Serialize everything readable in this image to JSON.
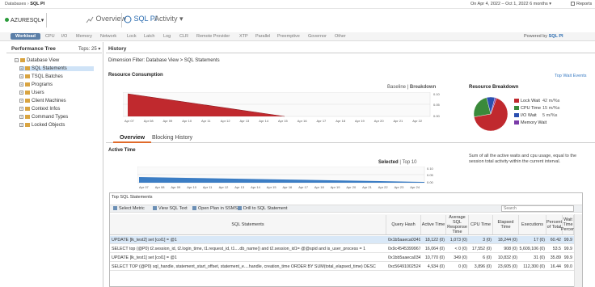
{
  "breadcrumb": {
    "parent": "Databases",
    "separator": "›",
    "current": "SQL PI"
  },
  "date_range": "On Apr 4, 2022 – Oct 1, 2022 6 months ▾",
  "reports_label": "Reports",
  "server": {
    "name": "AZURESQL",
    "chevron": "▾",
    "status_color": "#2a9b3a"
  },
  "nav": {
    "overview": "Overview",
    "sqlpi": "SQL PI",
    "activity": "Activity ▾"
  },
  "categories": [
    "Workload",
    "CPU",
    "I/O",
    "Memory",
    "Network",
    "Lock",
    "Latch",
    "Log",
    "CLR",
    "Remote Provider",
    "XTP",
    "Parallel",
    "Preemptive",
    "Governor",
    "Other"
  ],
  "powered_by": {
    "prefix": "Powered by",
    "brand": "SQL PI"
  },
  "performance_tree": {
    "title": "Performance Tree",
    "tops": "Tops: 25 ▾",
    "items": [
      "Database View",
      "SQL Statements",
      "TSQL Batches",
      "Programs",
      "Users",
      "Client Machines",
      "Context Infos",
      "Command Types",
      "Locked Objects"
    ]
  },
  "history": {
    "title": "History",
    "dimension_filter": "Dimension Filter: Database View > SQL Statements",
    "resource_consumption": "Resource Consumption",
    "baseline": "Baseline",
    "breakdown": "Breakdown",
    "resource_breakdown": "Resource Breakdown",
    "top_wait_events": "Top Wait Events",
    "legend": [
      {
        "label": "Lock Wait",
        "value": "42 m/%s",
        "color": "#c0292e"
      },
      {
        "label": "CPU Time",
        "value": "15 m/%s",
        "color": "#3a8a3a"
      },
      {
        "label": "I/O Wait",
        "value": "5 m/%s",
        "color": "#2a4fb0"
      },
      {
        "label": "Memory Wait",
        "value": "",
        "color": "#7a3aa8"
      }
    ],
    "pie_values": [
      42,
      15,
      5,
      1
    ]
  },
  "rc_chart": {
    "x_labels": [
      "Apr 07",
      "Apr 08",
      "Apr 09",
      "Apr 10",
      "Apr 11",
      "Apr 12",
      "Apr 13",
      "Apr 14",
      "Apr 15",
      "Apr 16",
      "Apr 17",
      "Apr 18",
      "Apr 19",
      "Apr 20",
      "Apr 21",
      "Apr 22"
    ],
    "y_labels": [
      "0.10",
      "0.05",
      "0.00"
    ]
  },
  "subtabs": {
    "overview": "Overview",
    "blocking_history": "Blocking History"
  },
  "active_time": {
    "title": "Active Time",
    "selected": "Selected",
    "top": "Top 10",
    "description": "Sum of all the active waits and cpu usage, equal to the session total activity within the current interval.",
    "x_labels": [
      "Apr 07",
      "Apr 08",
      "Apr 09",
      "Apr 10",
      "Apr 11",
      "Apr 12",
      "Apr 13",
      "Apr 14",
      "Apr 15",
      "Apr 16",
      "Apr 17",
      "Apr 18",
      "Apr 19",
      "Apr 20",
      "Apr 21",
      "Apr 22",
      "Apr 23",
      "Apr 24"
    ],
    "y_labels": [
      "0.10",
      "0.05",
      "0.00"
    ]
  },
  "top_sql": {
    "title": "Top SQL Statements",
    "toolbar": {
      "select_metric": "Select Metric",
      "view_sql": "View SQL Text",
      "open_ssms": "Open Plan in SSMS",
      "drill": "Drill to SQL Statement"
    },
    "search_placeholder": "Search",
    "headers": [
      "SQL Statements",
      "Query Hash",
      "Active Time",
      "Average SQL Response Time",
      "CPU Time",
      "Elapsed Time",
      "Executions",
      "Percent of Total",
      "Wait Time Percen"
    ],
    "rows": [
      [
        "UPDATE [lk_test2] set [col1] = @1",
        "0x1b5aaeca034917bb",
        "18,122 (0)",
        "1,073 (0)",
        "3 (0)",
        "18,244 (0)",
        "17 (0)",
        "60.42",
        "99.9"
      ],
      [
        "SELECT top (@P0) t2.session_id, t2.login_time, t1.request_id, t1....db_name() and t2.session_id1= @@spid and is_user_process = 1",
        "0x9c4545399967fd4a1",
        "16,064 (0)",
        "< 0 (0)",
        "17,552 (0)",
        "908 (0)",
        "5,609,106 (0)",
        "53.5",
        "99.9"
      ],
      [
        "UPDATE [lk_test1] set [col1] = @1",
        "0x1bb5aaeca03491fbb",
        "10,770 (0)",
        "349 (0)",
        "6 (0)",
        "10,832 (0)",
        "31 (0)",
        "35.89",
        "99.9"
      ],
      [
        "SELECT TOP (@P0) sql_handle, statement_start_offset, statement_e....handle, creation_time ORDER BY SUM(total_elapsed_time) DESC",
        "0xc56491002524374a",
        "4,934 (0)",
        "0 (0)",
        "3,896 (0)",
        "23,605 (0)",
        "112,300 (0)",
        "16.44",
        "99.0"
      ]
    ]
  }
}
